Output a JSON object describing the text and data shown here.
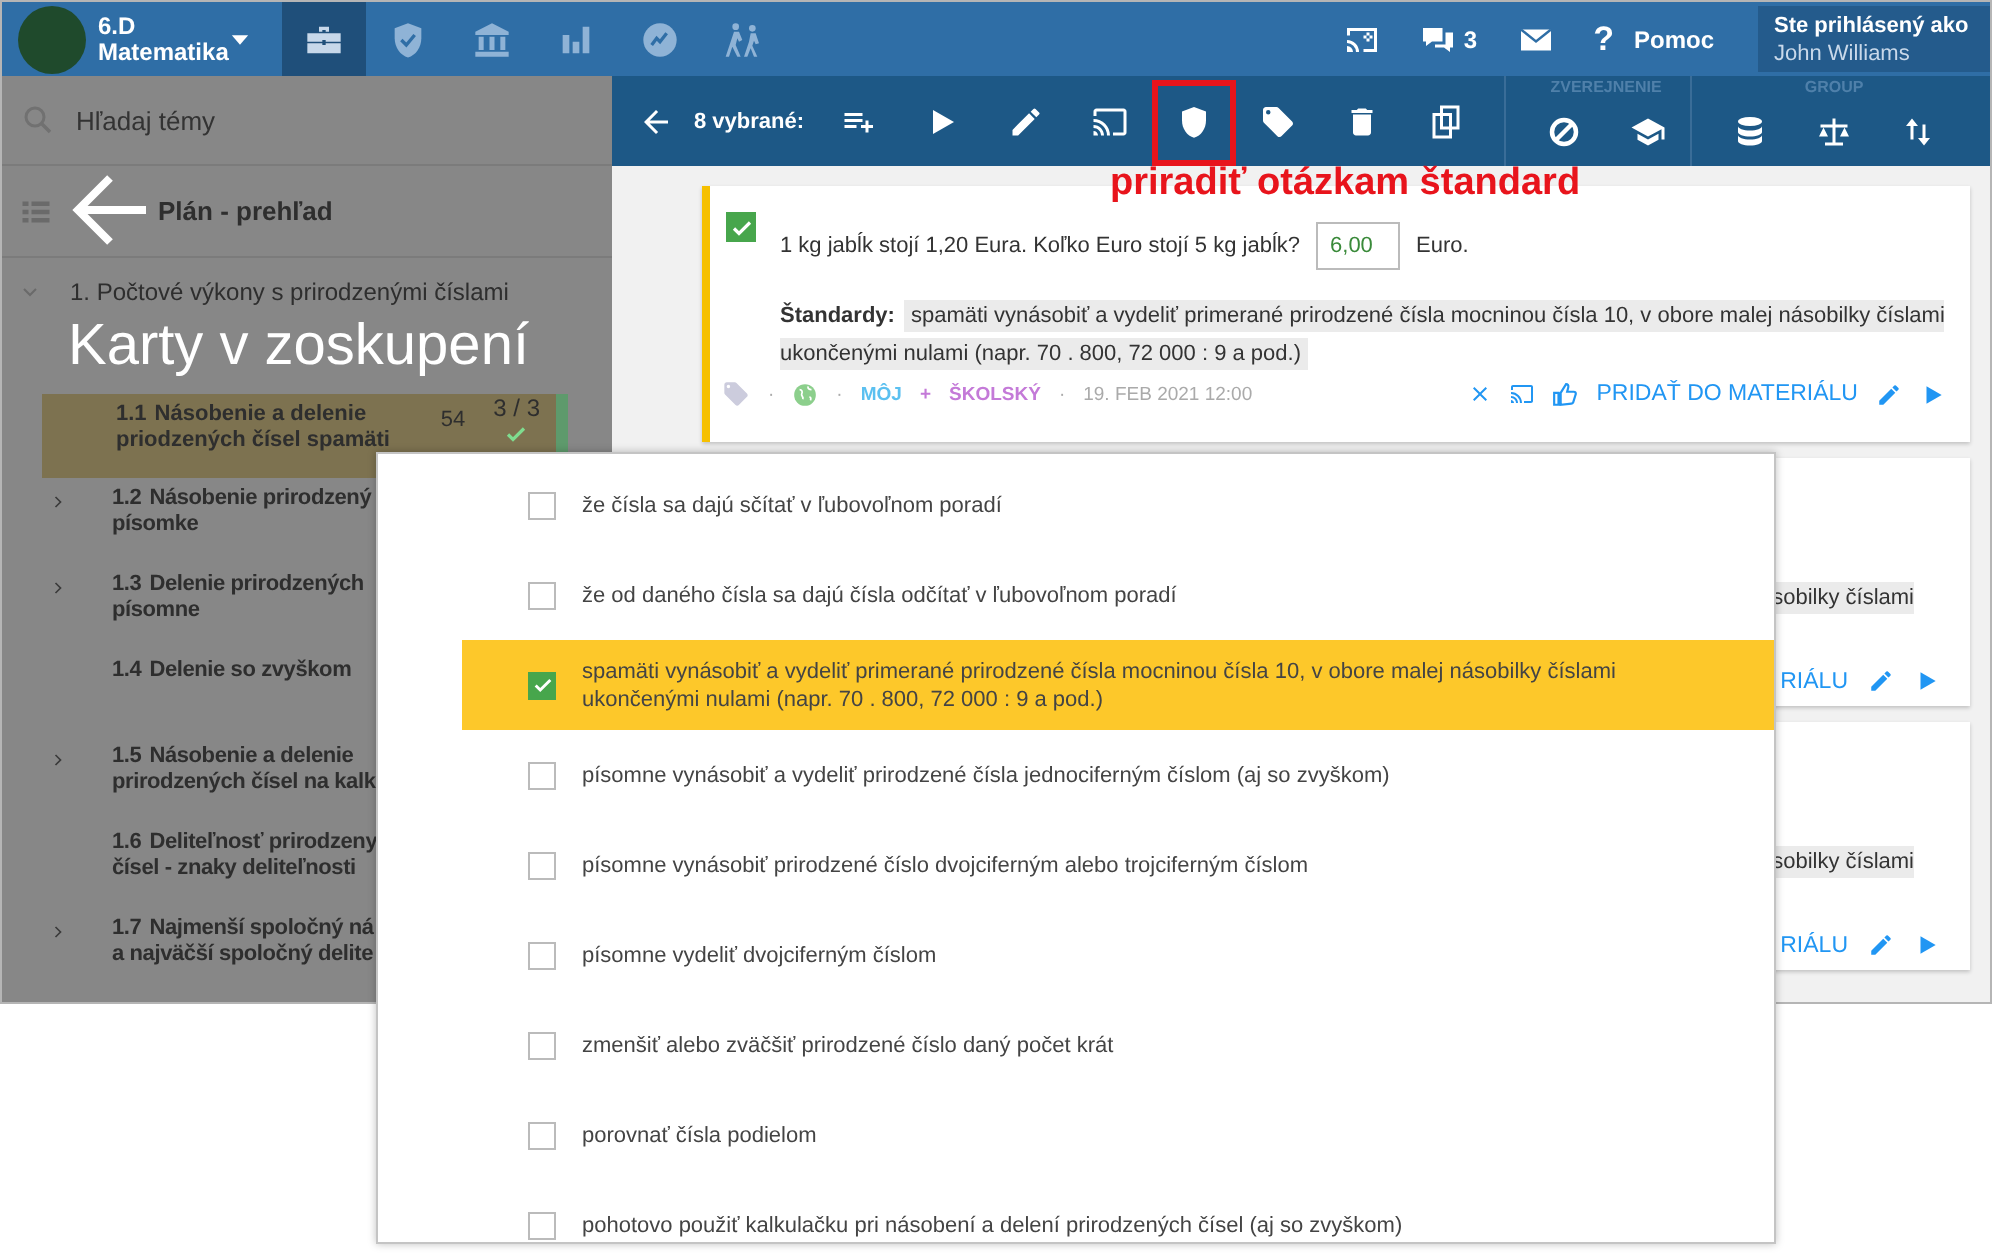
{
  "topbar": {
    "class_name": "6.D",
    "subject": "Matematika",
    "tabs": [
      {
        "kind": "briefcase",
        "selected": true
      },
      {
        "kind": "shield",
        "selected": false
      },
      {
        "kind": "bank",
        "selected": false
      },
      {
        "kind": "chart",
        "selected": false
      },
      {
        "kind": "badge",
        "selected": false
      },
      {
        "kind": "hikers",
        "selected": false
      }
    ],
    "messages_count": "3",
    "help_symbol": "?",
    "help_label": "Pomoc",
    "user": {
      "caption": "Ste prihlásený ako",
      "name": "John Williams"
    }
  },
  "sidebar": {
    "search": {
      "placeholder": "Hľadaj témy"
    },
    "overview_label": "Plán - prehľad",
    "section": {
      "title": "1. Počtové výkony s prirodzenými číslami",
      "expanded": true
    },
    "topics": [
      {
        "number": "1.1",
        "lines": [
          "Násobenie a delenie",
          "priodzených čísel spamäti"
        ],
        "expandable": false,
        "selected": true,
        "count": "54",
        "progress": "3 / 3",
        "done": true
      },
      {
        "number": "1.2",
        "lines": [
          "Násobenie prirodzený",
          "písomke"
        ],
        "expandable": true,
        "selected": false,
        "done": false
      },
      {
        "number": "1.3",
        "lines": [
          "Delenie prirodzených",
          "písomne"
        ],
        "expandable": true,
        "selected": false,
        "done": false
      },
      {
        "number": "1.4",
        "lines": [
          "Delenie so zvyškom"
        ],
        "expandable": false,
        "selected": false,
        "done": false
      },
      {
        "number": "1.5",
        "lines": [
          "Násobenie a delenie",
          "prirodzených čísel na kalk"
        ],
        "expandable": true,
        "selected": false,
        "done": false
      },
      {
        "number": "1.6",
        "lines": [
          "Deliteľnosť prirodzeny",
          "čísel - znaky deliteľnosti"
        ],
        "expandable": false,
        "selected": false,
        "done": false
      },
      {
        "number": "1.7",
        "lines": [
          "Najmenší spoločný ná",
          "a najväčší spoločný delite"
        ],
        "expandable": true,
        "selected": false,
        "done": false
      }
    ]
  },
  "toolbar": {
    "selection_label": "8 vybrané:",
    "actions": [
      {
        "kind": "add-to-list",
        "highlighted": false
      },
      {
        "kind": "play",
        "highlighted": false
      },
      {
        "kind": "edit",
        "highlighted": false
      },
      {
        "kind": "cast",
        "highlighted": false
      },
      {
        "kind": "shield",
        "highlighted": true
      },
      {
        "kind": "tag",
        "highlighted": false
      },
      {
        "kind": "delete",
        "highlighted": false
      },
      {
        "kind": "copy",
        "highlighted": false
      }
    ],
    "groups": [
      {
        "title": "ZVEREJNENIE",
        "actions": [
          {
            "kind": "ban"
          },
          {
            "kind": "graduation-cap"
          }
        ]
      },
      {
        "title": "GROUP",
        "actions": [
          {
            "kind": "database"
          },
          {
            "kind": "scale"
          },
          {
            "kind": "sort"
          }
        ]
      }
    ]
  },
  "overlay_title": "Karty v zoskupení",
  "annotation": {
    "text": "priradiť otázkam štandard"
  },
  "cards": [
    {
      "kind": "full",
      "checked": true,
      "question": "1 kg jabĺk stojí 1,20 Eura. Koľko Euro stojí 5 kg jabĺk?",
      "answer": "6,00",
      "unit": "Euro.",
      "standards_label": "Štandardy:",
      "standard": "spamäti vynásobiť a vydeliť primerané prirodzené čísla mocninou čísla 10, v obore malej násobilky číslami ukončenými nulami (napr. 70 . 800, 72 000 : 9 a pod.)",
      "separators": [
        "·",
        "·",
        "·"
      ],
      "owner": "MÔJ",
      "plus": "+",
      "scope": "ŠKOLSKÝ",
      "date": "19. FEB 2021 12:00",
      "add_label": "PRIDAŤ DO MATERIÁLU"
    },
    {
      "kind": "partial",
      "standard_end": "sobilky číslami",
      "add_label_end": "RIÁLU"
    },
    {
      "kind": "partial",
      "standard_end": "sobilky číslami",
      "add_label_end": "RIÁLU"
    }
  ],
  "dialog": {
    "standards": [
      {
        "text": "že čísla sa dajú sčítať v ľubovoľnom poradí",
        "checked": false
      },
      {
        "text": "že od daného čísla sa dajú čísla odčítať v ľubovoľnom poradí",
        "checked": false
      },
      {
        "text": "spamäti vynásobiť a vydeliť primerané prirodzené čísla mocninou čísla 10, v obore malej násobilky číslami ukončenými nulami (napr. 70 . 800, 72 000 : 9 a pod.)",
        "checked": true
      },
      {
        "text": "písomne vynásobiť a vydeliť prirodzené čísla jednociferným číslom (aj so zvyškom)",
        "checked": false
      },
      {
        "text": "písomne vynásobiť prirodzené číslo dvojciferným alebo trojciferným číslom",
        "checked": false
      },
      {
        "text": "písomne vydeliť dvojciferným číslom",
        "checked": false
      },
      {
        "text": "zmenšiť alebo zväčšiť prirodzené číslo daný počet krát",
        "checked": false
      },
      {
        "text": "porovnať čísla podielom",
        "checked": false
      },
      {
        "text": "pohotovo použiť kalkulačku pri násobení a delení prirodzených čísel (aj so zvyškom)",
        "checked": false
      }
    ]
  }
}
